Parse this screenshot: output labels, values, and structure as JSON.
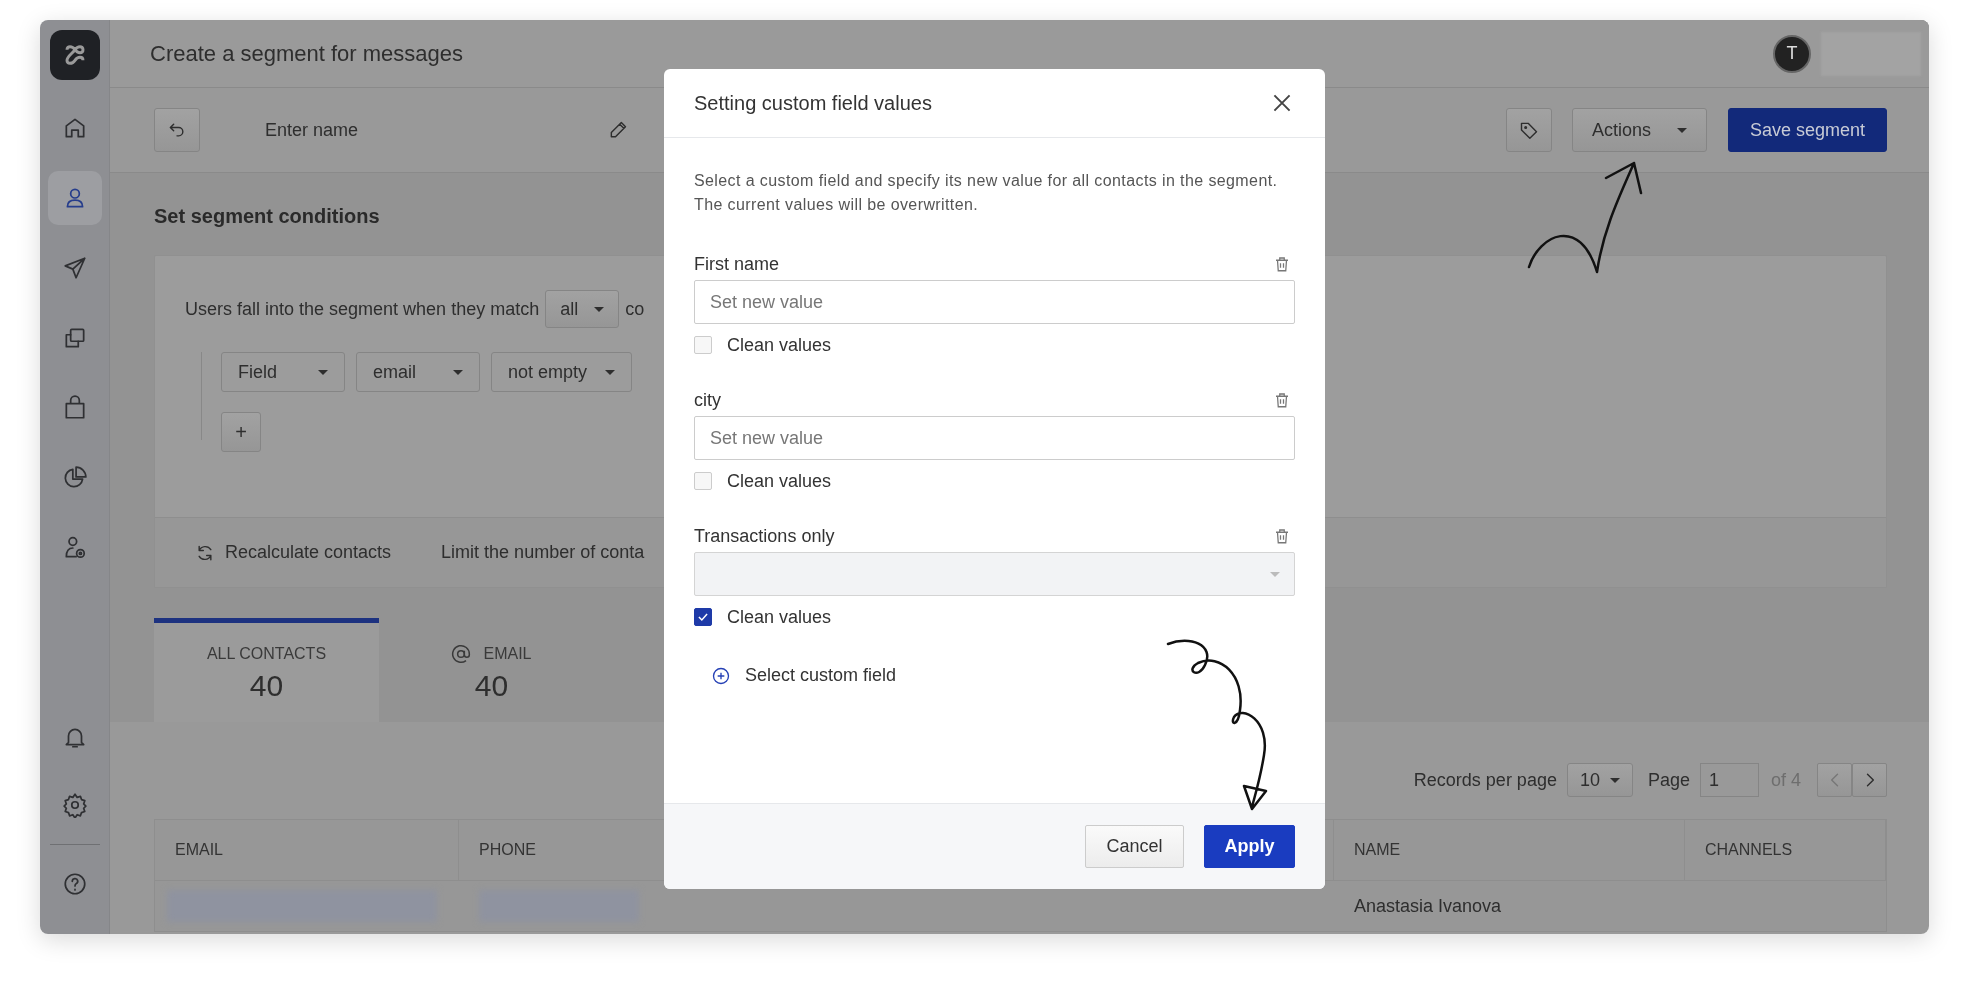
{
  "sidebar": {
    "items": [
      {
        "selected": false
      },
      {
        "selected": true
      },
      {
        "selected": false
      },
      {
        "selected": false
      },
      {
        "selected": false
      },
      {
        "selected": false
      },
      {
        "selected": false
      }
    ],
    "bottom_items": [
      {
        "selected": false
      },
      {
        "selected": false
      },
      {
        "selected": false
      }
    ]
  },
  "header": {
    "title": "Create a segment for messages",
    "avatar_initial": "T"
  },
  "toolbar": {
    "name_placeholder": "Enter name",
    "actions_label": "Actions",
    "save_label": "Save segment"
  },
  "conditions": {
    "title": "Set segment conditions",
    "match_prefix": "Users fall into the segment when they match",
    "match_value": "all",
    "match_suffix": "co",
    "rule": [
      "Field",
      "email",
      "not empty"
    ],
    "add_label": "+",
    "recalculate": "Recalculate contacts",
    "limit": "Limit the number of conta"
  },
  "tabs": [
    {
      "kind": "all",
      "label": "ALL CONTACTS",
      "count": "40",
      "selected": true
    },
    {
      "kind": "email",
      "label": "EMAIL",
      "count": "40",
      "selected": false
    }
  ],
  "pagination": {
    "label": "Records per page",
    "per_page": "10",
    "page_label": "Page",
    "page": "1",
    "of": "of 4"
  },
  "table": {
    "columns": [
      "EMAIL",
      "PHONE",
      "NAME",
      "CHANNELS"
    ],
    "rows": [
      {
        "name": "Anastasia Ivanova"
      }
    ]
  },
  "modal": {
    "title": "Setting custom field values",
    "description": "Select a custom field and specify its new value for all contacts in the segment. The current values will be overwritten.",
    "fields": [
      {
        "kind": "text",
        "label": "First name",
        "placeholder": "Set new value",
        "clean_label": "Clean values",
        "checked": false
      },
      {
        "kind": "text",
        "label": "city",
        "placeholder": "Set new value",
        "clean_label": "Clean values",
        "checked": false
      },
      {
        "kind": "select",
        "label": "Transactions only",
        "clean_label": "Clean values",
        "checked": true
      }
    ],
    "add_field": "Select custom field",
    "buttons": [
      {
        "kind": "secondary",
        "label": "Cancel"
      },
      {
        "kind": "primary",
        "label": "Apply"
      }
    ]
  }
}
